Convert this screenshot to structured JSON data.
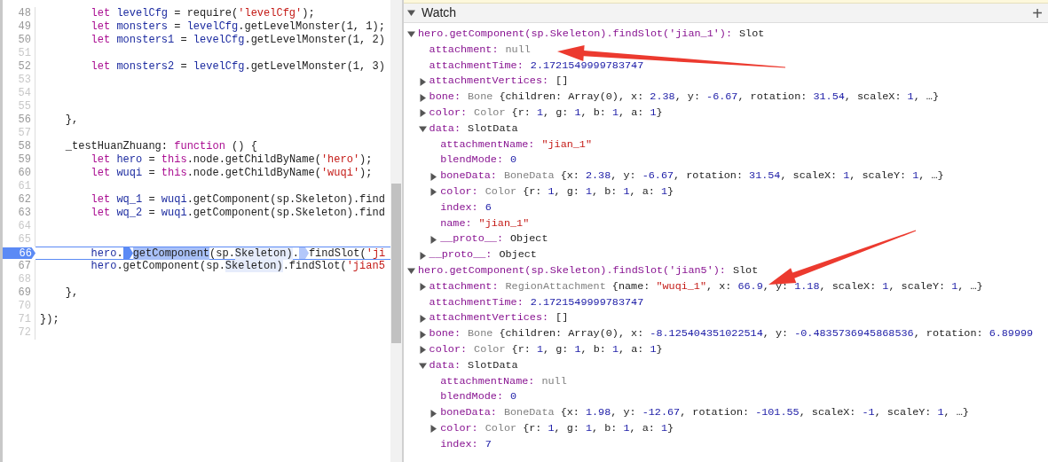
{
  "editor": {
    "lines": [
      {
        "number": "48",
        "executable": true,
        "selected": false,
        "tokens": [
          {
            "kind": "kw",
            "t": "        let"
          },
          {
            "kind": "def",
            "t": " levelCfg"
          },
          {
            "kind": "plain",
            "t": " = require("
          },
          {
            "kind": "str",
            "t": "'levelCfg'"
          },
          {
            "kind": "plain",
            "t": ");"
          }
        ]
      },
      {
        "number": "49",
        "executable": true,
        "selected": false,
        "tokens": [
          {
            "kind": "kw",
            "t": "        let"
          },
          {
            "kind": "def",
            "t": " monsters"
          },
          {
            "kind": "plain",
            "t": " = "
          },
          {
            "kind": "def",
            "t": "levelCfg"
          },
          {
            "kind": "plain",
            "t": ".getLevelMonster(1, 1);"
          }
        ]
      },
      {
        "number": "50",
        "executable": true,
        "selected": false,
        "tokens": [
          {
            "kind": "kw",
            "t": "        let"
          },
          {
            "kind": "def",
            "t": " monsters1"
          },
          {
            "kind": "plain",
            "t": " = "
          },
          {
            "kind": "def",
            "t": "levelCfg"
          },
          {
            "kind": "plain",
            "t": ".getLevelMonster(1, 2)"
          }
        ]
      },
      {
        "number": "51",
        "executable": false,
        "selected": false
      },
      {
        "number": "52",
        "executable": true,
        "selected": false,
        "tokens": [
          {
            "kind": "kw",
            "t": "        let"
          },
          {
            "kind": "def",
            "t": " monsters2"
          },
          {
            "kind": "plain",
            "t": " = "
          },
          {
            "kind": "def",
            "t": "levelCfg"
          },
          {
            "kind": "plain",
            "t": ".getLevelMonster(1, 3)"
          }
        ]
      },
      {
        "number": "53",
        "executable": false,
        "selected": false
      },
      {
        "number": "54",
        "executable": false,
        "selected": false
      },
      {
        "number": "55",
        "executable": false,
        "selected": false
      },
      {
        "number": "56",
        "executable": true,
        "selected": false,
        "tokens": [
          {
            "kind": "plain",
            "t": "    },"
          }
        ]
      },
      {
        "number": "57",
        "executable": false,
        "selected": false
      },
      {
        "number": "58",
        "executable": true,
        "selected": false,
        "tokens": [
          {
            "kind": "plain",
            "t": "    _testHuanZhuang: "
          },
          {
            "kind": "kw",
            "t": "function"
          },
          {
            "kind": "plain",
            "t": " () {"
          }
        ]
      },
      {
        "number": "59",
        "executable": true,
        "selected": false,
        "tokens": [
          {
            "kind": "kw",
            "t": "        let"
          },
          {
            "kind": "def",
            "t": " hero"
          },
          {
            "kind": "plain",
            "t": " = "
          },
          {
            "kind": "kw",
            "t": "this"
          },
          {
            "kind": "plain",
            "t": ".node.getChildByName("
          },
          {
            "kind": "str",
            "t": "'hero'"
          },
          {
            "kind": "plain",
            "t": ");"
          }
        ]
      },
      {
        "number": "60",
        "executable": true,
        "selected": false,
        "tokens": [
          {
            "kind": "kw",
            "t": "        let"
          },
          {
            "kind": "def",
            "t": " wuqi"
          },
          {
            "kind": "plain",
            "t": " = "
          },
          {
            "kind": "kw",
            "t": "this"
          },
          {
            "kind": "plain",
            "t": ".node.getChildByName("
          },
          {
            "kind": "str",
            "t": "'wuqi'"
          },
          {
            "kind": "plain",
            "t": ");"
          }
        ]
      },
      {
        "number": "61",
        "executable": false,
        "selected": false
      },
      {
        "number": "62",
        "executable": true,
        "selected": false,
        "tokens": [
          {
            "kind": "kw",
            "t": "        let"
          },
          {
            "kind": "def",
            "t": " wq_1"
          },
          {
            "kind": "plain",
            "t": " = "
          },
          {
            "kind": "def",
            "t": "wuqi"
          },
          {
            "kind": "plain",
            "t": ".getComponent(sp.Skeleton).find"
          }
        ]
      },
      {
        "number": "63",
        "executable": true,
        "selected": false,
        "tokens": [
          {
            "kind": "kw",
            "t": "        let"
          },
          {
            "kind": "def",
            "t": " wq_2"
          },
          {
            "kind": "plain",
            "t": " = "
          },
          {
            "kind": "def",
            "t": "wuqi"
          },
          {
            "kind": "plain",
            "t": ".getComponent(sp.Skeleton).find"
          }
        ]
      },
      {
        "number": "64",
        "executable": false,
        "selected": false
      },
      {
        "number": "65",
        "executable": false,
        "selected": false
      },
      {
        "number": "66",
        "executable": true,
        "selected": true,
        "tokens": [
          {
            "kind": "def",
            "t": "        hero"
          },
          {
            "kind": "plain",
            "t": "."
          },
          {
            "kind": "marker",
            "active": true
          },
          {
            "kind": "hl",
            "t": "getComponent"
          },
          {
            "kind": "plain",
            "t": "(sp."
          },
          {
            "kind": "hlsoft",
            "t": "Skeleton)"
          },
          {
            "kind": "plain",
            "t": "."
          },
          {
            "kind": "marker",
            "active": false
          },
          {
            "kind": "plain",
            "t": "findSlot("
          },
          {
            "kind": "str",
            "t": "'ji"
          }
        ]
      },
      {
        "number": "67",
        "executable": true,
        "selected": false,
        "tokens": [
          {
            "kind": "def",
            "t": "        hero"
          },
          {
            "kind": "plain",
            "t": ".getComponent(sp."
          },
          {
            "kind": "hlsoft",
            "t": "Skeleton)"
          },
          {
            "kind": "plain",
            "t": ".findSlot("
          },
          {
            "kind": "str",
            "t": "'jian5"
          }
        ]
      },
      {
        "number": "68",
        "executable": false,
        "selected": false
      },
      {
        "number": "69",
        "executable": true,
        "selected": false,
        "tokens": [
          {
            "kind": "plain",
            "t": "    },"
          }
        ]
      },
      {
        "number": "70",
        "executable": false,
        "selected": false
      },
      {
        "number": "71",
        "executable": false,
        "selected": false,
        "tokens": [
          {
            "kind": "plain",
            "t": "});"
          }
        ]
      },
      {
        "number": "72",
        "executable": false,
        "selected": false
      }
    ]
  },
  "watch": {
    "title": "Watch",
    "expanded": true,
    "add_label": "+",
    "items": [
      {
        "kind": "node",
        "expanded": true,
        "key": "hero.getComponent(sp.Skeleton).findSlot('jian_1'):",
        "value": [
          {
            "kind": "plain",
            "t": "Slot"
          }
        ],
        "children": [
          {
            "kind": "leaf",
            "key": "attachment:",
            "value": [
              {
                "kind": "null",
                "t": "null"
              }
            ]
          },
          {
            "kind": "leaf",
            "key": "attachmentTime:",
            "value": [
              {
                "kind": "num",
                "t": "2.1721549999783747"
              }
            ]
          },
          {
            "kind": "node",
            "expanded": false,
            "key": "attachmentVertices:",
            "value": [
              {
                "kind": "plain",
                "t": "[]"
              }
            ]
          },
          {
            "kind": "node",
            "expanded": false,
            "key": "bone:",
            "value": [
              {
                "kind": "type",
                "t": "Bone"
              },
              {
                "kind": "plain",
                "t": " {children: Array(0), x: "
              },
              {
                "kind": "num",
                "t": "2.38"
              },
              {
                "kind": "plain",
                "t": ", y: "
              },
              {
                "kind": "num",
                "t": "-6.67"
              },
              {
                "kind": "plain",
                "t": ", rotation: "
              },
              {
                "kind": "num",
                "t": "31.54"
              },
              {
                "kind": "plain",
                "t": ", scaleX: "
              },
              {
                "kind": "num",
                "t": "1"
              },
              {
                "kind": "plain",
                "t": ", …}"
              }
            ]
          },
          {
            "kind": "node",
            "expanded": false,
            "key": "color:",
            "value": [
              {
                "kind": "type",
                "t": "Color"
              },
              {
                "kind": "plain",
                "t": " {r: "
              },
              {
                "kind": "num",
                "t": "1"
              },
              {
                "kind": "plain",
                "t": ", g: "
              },
              {
                "kind": "num",
                "t": "1"
              },
              {
                "kind": "plain",
                "t": ", b: "
              },
              {
                "kind": "num",
                "t": "1"
              },
              {
                "kind": "plain",
                "t": ", a: "
              },
              {
                "kind": "num",
                "t": "1"
              },
              {
                "kind": "plain",
                "t": "}"
              }
            ]
          },
          {
            "kind": "node",
            "expanded": true,
            "key": "data:",
            "value": [
              {
                "kind": "plain",
                "t": "SlotData"
              }
            ],
            "children": [
              {
                "kind": "leaf",
                "key": "attachmentName:",
                "value": [
                  {
                    "kind": "str",
                    "t": "\"jian_1\""
                  }
                ]
              },
              {
                "kind": "leaf",
                "key": "blendMode:",
                "value": [
                  {
                    "kind": "num",
                    "t": "0"
                  }
                ]
              },
              {
                "kind": "node",
                "expanded": false,
                "key": "boneData:",
                "value": [
                  {
                    "kind": "type",
                    "t": "BoneData"
                  },
                  {
                    "kind": "plain",
                    "t": " {x: "
                  },
                  {
                    "kind": "num",
                    "t": "2.38"
                  },
                  {
                    "kind": "plain",
                    "t": ", y: "
                  },
                  {
                    "kind": "num",
                    "t": "-6.67"
                  },
                  {
                    "kind": "plain",
                    "t": ", rotation: "
                  },
                  {
                    "kind": "num",
                    "t": "31.54"
                  },
                  {
                    "kind": "plain",
                    "t": ", scaleX: "
                  },
                  {
                    "kind": "num",
                    "t": "1"
                  },
                  {
                    "kind": "plain",
                    "t": ", scaleY: "
                  },
                  {
                    "kind": "num",
                    "t": "1"
                  },
                  {
                    "kind": "plain",
                    "t": ", …}"
                  }
                ]
              },
              {
                "kind": "node",
                "expanded": false,
                "key": "color:",
                "value": [
                  {
                    "kind": "type",
                    "t": "Color"
                  },
                  {
                    "kind": "plain",
                    "t": " {r: "
                  },
                  {
                    "kind": "num",
                    "t": "1"
                  },
                  {
                    "kind": "plain",
                    "t": ", g: "
                  },
                  {
                    "kind": "num",
                    "t": "1"
                  },
                  {
                    "kind": "plain",
                    "t": ", b: "
                  },
                  {
                    "kind": "num",
                    "t": "1"
                  },
                  {
                    "kind": "plain",
                    "t": ", a: "
                  },
                  {
                    "kind": "num",
                    "t": "1"
                  },
                  {
                    "kind": "plain",
                    "t": "}"
                  }
                ]
              },
              {
                "kind": "leaf",
                "key": "index:",
                "value": [
                  {
                    "kind": "num",
                    "t": "6"
                  }
                ]
              },
              {
                "kind": "leaf",
                "key": "name:",
                "value": [
                  {
                    "kind": "str",
                    "t": "\"jian_1\""
                  }
                ]
              },
              {
                "kind": "node",
                "expanded": false,
                "key": "__proto__:",
                "value": [
                  {
                    "kind": "plain",
                    "t": "Object"
                  }
                ]
              }
            ]
          },
          {
            "kind": "node",
            "expanded": false,
            "key": "__proto__:",
            "value": [
              {
                "kind": "plain",
                "t": "Object"
              }
            ]
          }
        ]
      },
      {
        "kind": "node",
        "expanded": true,
        "key": "hero.getComponent(sp.Skeleton).findSlot('jian5'):",
        "value": [
          {
            "kind": "plain",
            "t": "Slot"
          }
        ],
        "children": [
          {
            "kind": "node",
            "expanded": false,
            "key": "attachment:",
            "value": [
              {
                "kind": "type",
                "t": "RegionAttachment"
              },
              {
                "kind": "plain",
                "t": " {name: "
              },
              {
                "kind": "str",
                "t": "\"wuqi_1\""
              },
              {
                "kind": "plain",
                "t": ", x: "
              },
              {
                "kind": "num",
                "t": "66.9"
              },
              {
                "kind": "plain",
                "t": ", y: "
              },
              {
                "kind": "num",
                "t": "1.18"
              },
              {
                "kind": "plain",
                "t": ", scaleX: "
              },
              {
                "kind": "num",
                "t": "1"
              },
              {
                "kind": "plain",
                "t": ", scaleY: "
              },
              {
                "kind": "num",
                "t": "1"
              },
              {
                "kind": "plain",
                "t": ", …}"
              }
            ]
          },
          {
            "kind": "leaf",
            "key": "attachmentTime:",
            "value": [
              {
                "kind": "num",
                "t": "2.1721549999783747"
              }
            ]
          },
          {
            "kind": "node",
            "expanded": false,
            "key": "attachmentVertices:",
            "value": [
              {
                "kind": "plain",
                "t": "[]"
              }
            ]
          },
          {
            "kind": "node",
            "expanded": false,
            "key": "bone:",
            "value": [
              {
                "kind": "type",
                "t": "Bone"
              },
              {
                "kind": "plain",
                "t": " {children: Array(0), x: "
              },
              {
                "kind": "num",
                "t": "-8.125404351022514"
              },
              {
                "kind": "plain",
                "t": ", y: "
              },
              {
                "kind": "num",
                "t": "-0.4835736945868536"
              },
              {
                "kind": "plain",
                "t": ", rotation: "
              },
              {
                "kind": "num",
                "t": "6.89999"
              }
            ]
          },
          {
            "kind": "node",
            "expanded": false,
            "key": "color:",
            "value": [
              {
                "kind": "type",
                "t": "Color"
              },
              {
                "kind": "plain",
                "t": " {r: "
              },
              {
                "kind": "num",
                "t": "1"
              },
              {
                "kind": "plain",
                "t": ", g: "
              },
              {
                "kind": "num",
                "t": "1"
              },
              {
                "kind": "plain",
                "t": ", b: "
              },
              {
                "kind": "num",
                "t": "1"
              },
              {
                "kind": "plain",
                "t": ", a: "
              },
              {
                "kind": "num",
                "t": "1"
              },
              {
                "kind": "plain",
                "t": "}"
              }
            ]
          },
          {
            "kind": "node",
            "expanded": true,
            "key": "data:",
            "value": [
              {
                "kind": "plain",
                "t": "SlotData"
              }
            ],
            "children": [
              {
                "kind": "leaf",
                "key": "attachmentName:",
                "value": [
                  {
                    "kind": "null",
                    "t": "null"
                  }
                ]
              },
              {
                "kind": "leaf",
                "key": "blendMode:",
                "value": [
                  {
                    "kind": "num",
                    "t": "0"
                  }
                ]
              },
              {
                "kind": "node",
                "expanded": false,
                "key": "boneData:",
                "value": [
                  {
                    "kind": "type",
                    "t": "BoneData"
                  },
                  {
                    "kind": "plain",
                    "t": " {x: "
                  },
                  {
                    "kind": "num",
                    "t": "1.98"
                  },
                  {
                    "kind": "plain",
                    "t": ", y: "
                  },
                  {
                    "kind": "num",
                    "t": "-12.67"
                  },
                  {
                    "kind": "plain",
                    "t": ", rotation: "
                  },
                  {
                    "kind": "num",
                    "t": "-101.55"
                  },
                  {
                    "kind": "plain",
                    "t": ", scaleX: "
                  },
                  {
                    "kind": "num",
                    "t": "-1"
                  },
                  {
                    "kind": "plain",
                    "t": ", scaleY: "
                  },
                  {
                    "kind": "num",
                    "t": "1"
                  },
                  {
                    "kind": "plain",
                    "t": ", …}"
                  }
                ]
              },
              {
                "kind": "node",
                "expanded": false,
                "key": "color:",
                "value": [
                  {
                    "kind": "type",
                    "t": "Color"
                  },
                  {
                    "kind": "plain",
                    "t": " {r: "
                  },
                  {
                    "kind": "num",
                    "t": "1"
                  },
                  {
                    "kind": "plain",
                    "t": ", g: "
                  },
                  {
                    "kind": "num",
                    "t": "1"
                  },
                  {
                    "kind": "plain",
                    "t": ", b: "
                  },
                  {
                    "kind": "num",
                    "t": "1"
                  },
                  {
                    "kind": "plain",
                    "t": ", a: "
                  },
                  {
                    "kind": "num",
                    "t": "1"
                  },
                  {
                    "kind": "plain",
                    "t": "}"
                  }
                ]
              },
              {
                "kind": "leaf",
                "key": "index:",
                "value": [
                  {
                    "kind": "num",
                    "t": "7"
                  }
                ]
              }
            ]
          }
        ]
      }
    ]
  }
}
